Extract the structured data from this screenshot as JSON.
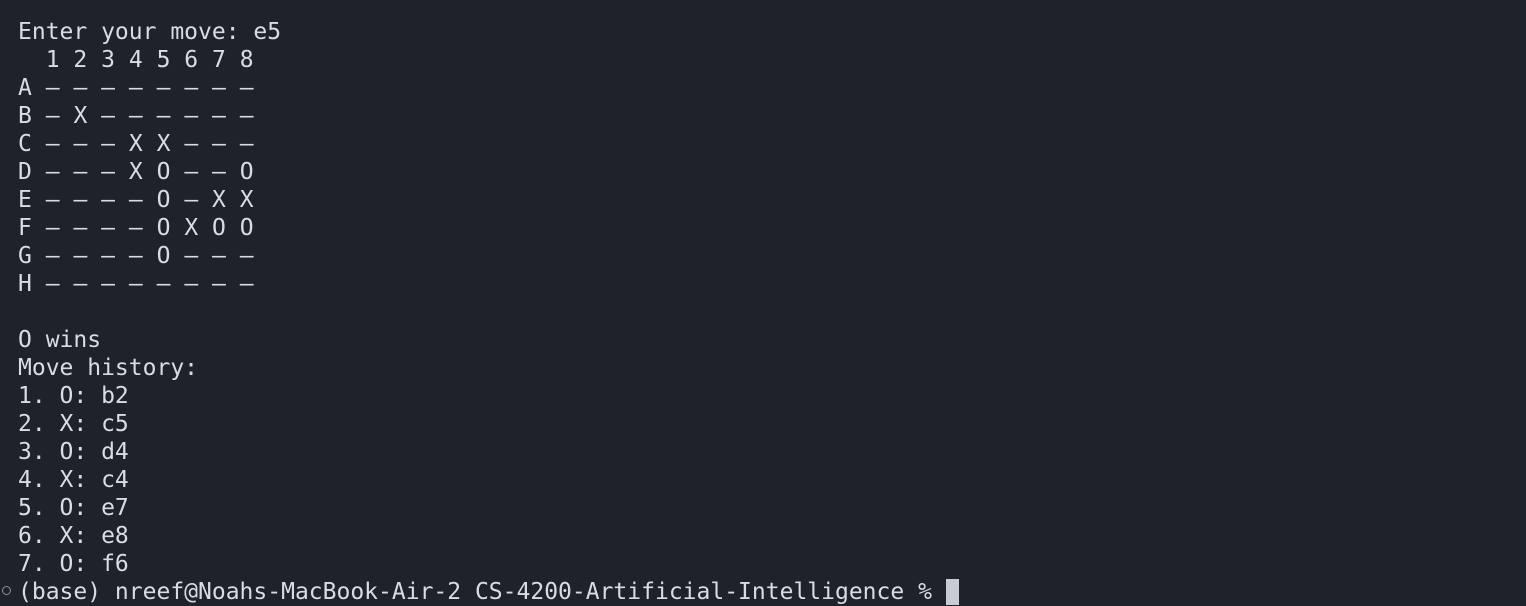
{
  "prompt": {
    "label": "Enter your move:",
    "value": "e5"
  },
  "board": {
    "columns": [
      "1",
      "2",
      "3",
      "4",
      "5",
      "6",
      "7",
      "8"
    ],
    "rows": [
      {
        "label": "A",
        "cells": [
          "–",
          "–",
          "–",
          "–",
          "–",
          "–",
          "–",
          "–"
        ]
      },
      {
        "label": "B",
        "cells": [
          "–",
          "X",
          "–",
          "–",
          "–",
          "–",
          "–",
          "–"
        ]
      },
      {
        "label": "C",
        "cells": [
          "–",
          "–",
          "–",
          "X",
          "X",
          "–",
          "–",
          "–"
        ]
      },
      {
        "label": "D",
        "cells": [
          "–",
          "–",
          "–",
          "X",
          "O",
          "–",
          "–",
          "O"
        ]
      },
      {
        "label": "E",
        "cells": [
          "–",
          "–",
          "–",
          "–",
          "O",
          "–",
          "X",
          "X"
        ]
      },
      {
        "label": "F",
        "cells": [
          "–",
          "–",
          "–",
          "–",
          "O",
          "X",
          "O",
          "O"
        ]
      },
      {
        "label": "G",
        "cells": [
          "–",
          "–",
          "–",
          "–",
          "O",
          "–",
          "–",
          "–"
        ]
      },
      {
        "label": "H",
        "cells": [
          "–",
          "–",
          "–",
          "–",
          "–",
          "–",
          "–",
          "–"
        ]
      }
    ]
  },
  "result": "O wins",
  "history": {
    "title": "Move history:",
    "moves": [
      "1. O: b2",
      "2. X: c5",
      "3. O: d4",
      "4. X: c4",
      "5. O: e7",
      "6. X: e8",
      "7. O: f6"
    ]
  },
  "shell_prompt": "(base) nreef@Noahs-MacBook-Air-2 CS-4200-Artificial-Intelligence %",
  "colors": {
    "background": "#1e222b",
    "text": "#d9dde3",
    "cursor": "#c8ccd2"
  }
}
